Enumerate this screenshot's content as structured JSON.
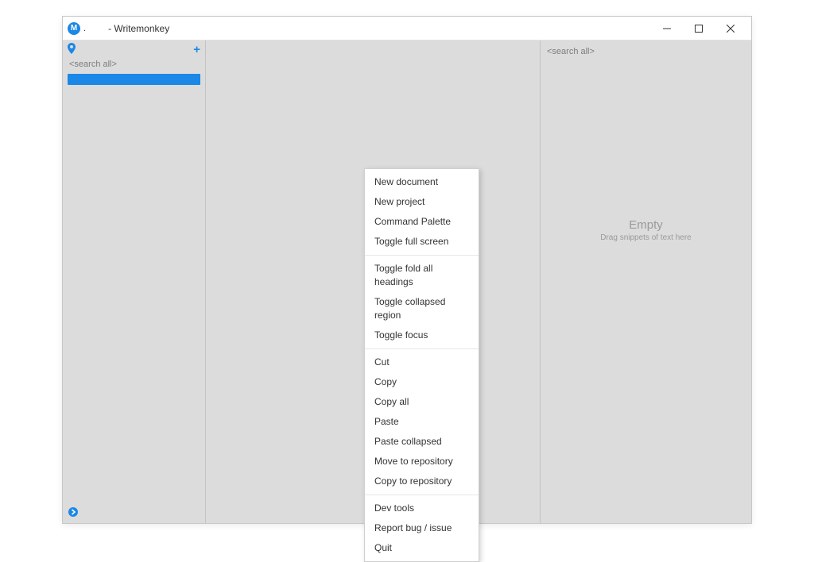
{
  "titlebar": {
    "app_icon_letter": "M",
    "doc_indicator": ".",
    "title": "- Writemonkey"
  },
  "left": {
    "search_placeholder": "<search all>"
  },
  "right": {
    "search_placeholder": "<search all>",
    "empty_title": "Empty",
    "empty_subtitle": "Drag snippets of text here"
  },
  "context_menu": {
    "group1": {
      "new_document": "New document",
      "new_project": "New project",
      "command_palette": "Command Palette",
      "toggle_full_screen": "Toggle full screen"
    },
    "group2": {
      "toggle_fold_headings": "Toggle fold all headings",
      "toggle_collapsed_region": "Toggle collapsed region",
      "toggle_focus": "Toggle focus"
    },
    "group3": {
      "cut": "Cut",
      "copy": "Copy",
      "copy_all": "Copy all",
      "paste": "Paste",
      "paste_collapsed": "Paste collapsed",
      "move_to_repository": "Move to repository",
      "copy_to_repository": "Copy to repository"
    },
    "group4": {
      "dev_tools": "Dev tools",
      "report_bug": "Report bug / issue",
      "quit": "Quit"
    }
  }
}
